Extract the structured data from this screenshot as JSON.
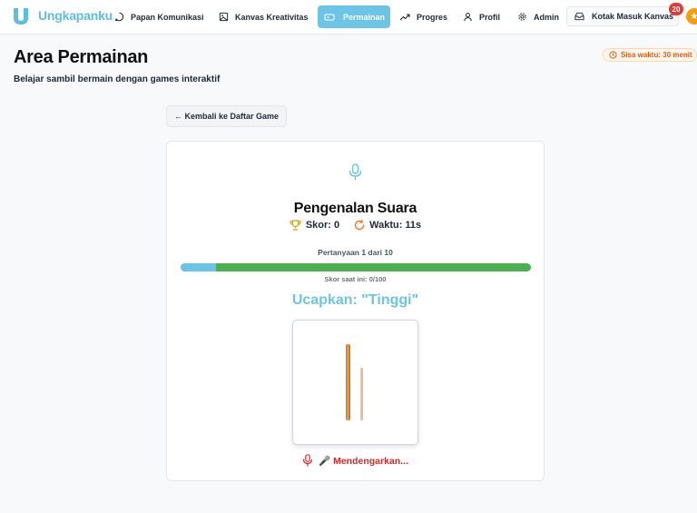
{
  "nav": {
    "brand": "Ungkapanku",
    "items": [
      {
        "label": "Papan Komunikasi",
        "icon": "chat-bubble-icon"
      },
      {
        "label": "Kanvas Kreativitas",
        "icon": "image-icon"
      },
      {
        "label": "Permainan",
        "icon": "gamepad-icon",
        "active": true
      },
      {
        "label": "Progres",
        "icon": "trending-up-icon"
      },
      {
        "label": "Profil",
        "icon": "user-icon"
      },
      {
        "label": "Admin",
        "icon": "gear-icon"
      }
    ],
    "inbox_label": "Kotak Masuk Kanvas",
    "inbox_badge": "20"
  },
  "header": {
    "title": "Area Permainan",
    "subtitle": "Belajar sambil bermain dengan games interaktif",
    "time_left": "Sisa waktu: 30 menit"
  },
  "back_button": "← Kembali ke Daftar Game",
  "game": {
    "title": "Pengenalan Suara",
    "score": "Skor: 0",
    "time": "Waktu: 11s",
    "question_counter": "Pertanyaan 1 dari 10",
    "progress_fraction": 0.1,
    "current_score": "Skor saat ini: 0/100",
    "prompt": "Ucapkan: \"Tinggi\"",
    "status": "🎤 Mendengarkan..."
  },
  "colors": {
    "brand": "#5bbfe0",
    "active_nav": "#6cc5e6",
    "progress_fill": "#6cc5e6",
    "progress_track": "#4caf50",
    "listening": "#dc2626",
    "timer": "#ea580c"
  }
}
